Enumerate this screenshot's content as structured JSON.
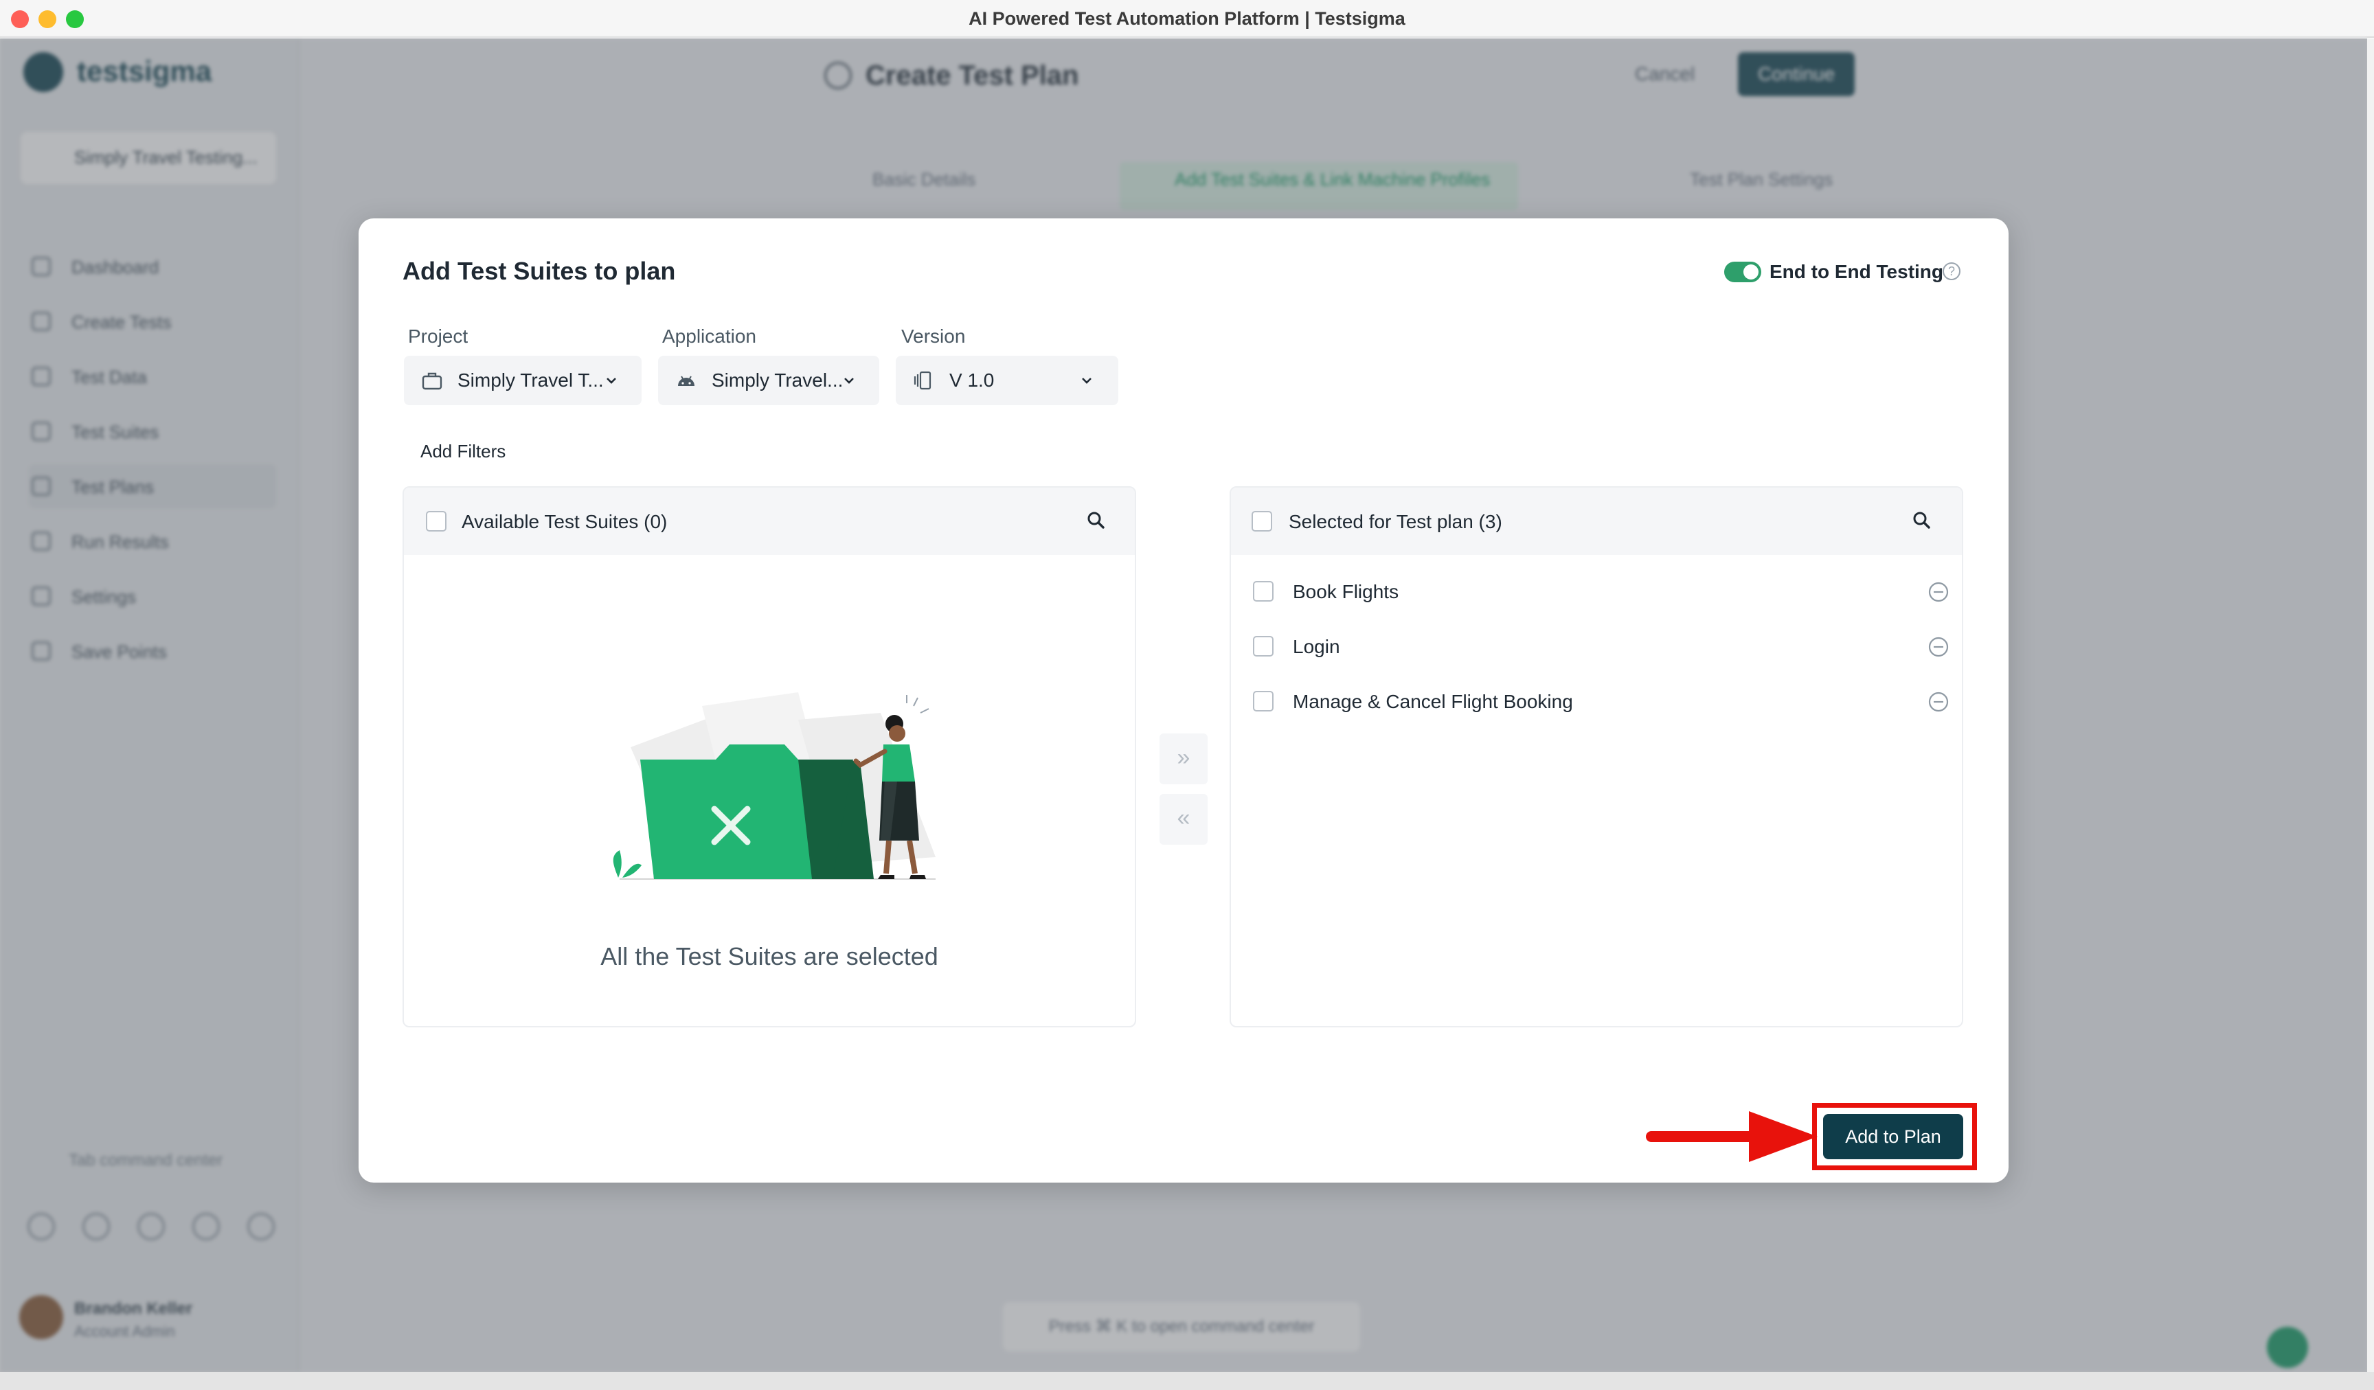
{
  "window": {
    "title": "AI Powered Test Automation Platform | Testsigma"
  },
  "background": {
    "brand": "testsigma",
    "project_pill": "Simply Travel Testing...",
    "sidebar_items": [
      "Dashboard",
      "Create Tests",
      "Test Data",
      "Test Suites",
      "Test Plans",
      "Run Results",
      "Settings",
      "Save Points"
    ],
    "sidebar_active_index": 4,
    "page_title": "Create Test Plan",
    "cancel_label": "Cancel",
    "continue_label": "Continue",
    "steps": [
      "Basic Details",
      "Add Test Suites & Link Machine Profiles",
      "Test Plan Settings"
    ],
    "command_center": "Tab command center",
    "command_hint": "Press ⌘ K to open command center",
    "user_name": "Brandon Keller",
    "user_role": "Account Admin"
  },
  "modal": {
    "title": "Add Test Suites to plan",
    "toggle": {
      "label": "End to End Testing",
      "on": true,
      "help_icon": "question-circle-icon"
    },
    "fields": {
      "project": {
        "label": "Project",
        "value": "Simply Travel T...",
        "icon": "briefcase-icon"
      },
      "application": {
        "label": "Application",
        "value": "Simply Travel...",
        "icon": "android-icon"
      },
      "version": {
        "label": "Version",
        "value": "V 1.0",
        "icon": "versions-icon"
      }
    },
    "add_filters_label": "Add Filters",
    "available": {
      "title": "Available Test Suites (0)",
      "empty_message": "All the Test Suites are selected",
      "items": []
    },
    "move_right_glyph": "»",
    "move_left_glyph": "«",
    "selected": {
      "title": "Selected for Test plan (3)",
      "items": [
        {
          "label": "Book Flights"
        },
        {
          "label": "Login"
        },
        {
          "label": "Manage & Cancel Flight Booking"
        }
      ]
    },
    "primary_button": "Add to Plan"
  },
  "colors": {
    "brand": "#0f3d4a",
    "toggle_on": "#2e9f6b",
    "highlight": "#e8120c",
    "folder_green": "#22b573",
    "folder_dark": "#15603e"
  }
}
